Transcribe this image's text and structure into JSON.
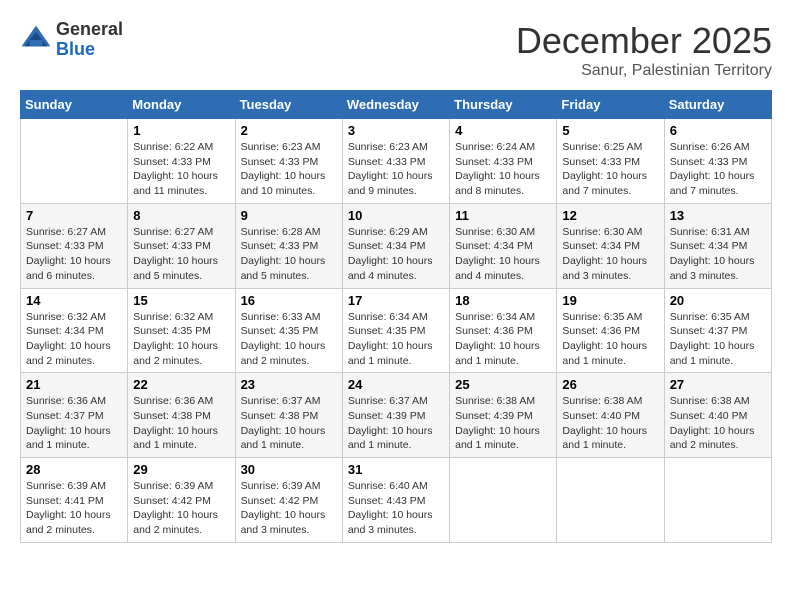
{
  "logo": {
    "general": "General",
    "blue": "Blue"
  },
  "title": "December 2025",
  "subtitle": "Sanur, Palestinian Territory",
  "days_of_week": [
    "Sunday",
    "Monday",
    "Tuesday",
    "Wednesday",
    "Thursday",
    "Friday",
    "Saturday"
  ],
  "weeks": [
    [
      {
        "day": "",
        "info": ""
      },
      {
        "day": "1",
        "info": "Sunrise: 6:22 AM\nSunset: 4:33 PM\nDaylight: 10 hours and 11 minutes."
      },
      {
        "day": "2",
        "info": "Sunrise: 6:23 AM\nSunset: 4:33 PM\nDaylight: 10 hours and 10 minutes."
      },
      {
        "day": "3",
        "info": "Sunrise: 6:23 AM\nSunset: 4:33 PM\nDaylight: 10 hours and 9 minutes."
      },
      {
        "day": "4",
        "info": "Sunrise: 6:24 AM\nSunset: 4:33 PM\nDaylight: 10 hours and 8 minutes."
      },
      {
        "day": "5",
        "info": "Sunrise: 6:25 AM\nSunset: 4:33 PM\nDaylight: 10 hours and 7 minutes."
      },
      {
        "day": "6",
        "info": "Sunrise: 6:26 AM\nSunset: 4:33 PM\nDaylight: 10 hours and 7 minutes."
      }
    ],
    [
      {
        "day": "7",
        "info": "Sunrise: 6:27 AM\nSunset: 4:33 PM\nDaylight: 10 hours and 6 minutes."
      },
      {
        "day": "8",
        "info": "Sunrise: 6:27 AM\nSunset: 4:33 PM\nDaylight: 10 hours and 5 minutes."
      },
      {
        "day": "9",
        "info": "Sunrise: 6:28 AM\nSunset: 4:33 PM\nDaylight: 10 hours and 5 minutes."
      },
      {
        "day": "10",
        "info": "Sunrise: 6:29 AM\nSunset: 4:34 PM\nDaylight: 10 hours and 4 minutes."
      },
      {
        "day": "11",
        "info": "Sunrise: 6:30 AM\nSunset: 4:34 PM\nDaylight: 10 hours and 4 minutes."
      },
      {
        "day": "12",
        "info": "Sunrise: 6:30 AM\nSunset: 4:34 PM\nDaylight: 10 hours and 3 minutes."
      },
      {
        "day": "13",
        "info": "Sunrise: 6:31 AM\nSunset: 4:34 PM\nDaylight: 10 hours and 3 minutes."
      }
    ],
    [
      {
        "day": "14",
        "info": "Sunrise: 6:32 AM\nSunset: 4:34 PM\nDaylight: 10 hours and 2 minutes."
      },
      {
        "day": "15",
        "info": "Sunrise: 6:32 AM\nSunset: 4:35 PM\nDaylight: 10 hours and 2 minutes."
      },
      {
        "day": "16",
        "info": "Sunrise: 6:33 AM\nSunset: 4:35 PM\nDaylight: 10 hours and 2 minutes."
      },
      {
        "day": "17",
        "info": "Sunrise: 6:34 AM\nSunset: 4:35 PM\nDaylight: 10 hours and 1 minute."
      },
      {
        "day": "18",
        "info": "Sunrise: 6:34 AM\nSunset: 4:36 PM\nDaylight: 10 hours and 1 minute."
      },
      {
        "day": "19",
        "info": "Sunrise: 6:35 AM\nSunset: 4:36 PM\nDaylight: 10 hours and 1 minute."
      },
      {
        "day": "20",
        "info": "Sunrise: 6:35 AM\nSunset: 4:37 PM\nDaylight: 10 hours and 1 minute."
      }
    ],
    [
      {
        "day": "21",
        "info": "Sunrise: 6:36 AM\nSunset: 4:37 PM\nDaylight: 10 hours and 1 minute."
      },
      {
        "day": "22",
        "info": "Sunrise: 6:36 AM\nSunset: 4:38 PM\nDaylight: 10 hours and 1 minute."
      },
      {
        "day": "23",
        "info": "Sunrise: 6:37 AM\nSunset: 4:38 PM\nDaylight: 10 hours and 1 minute."
      },
      {
        "day": "24",
        "info": "Sunrise: 6:37 AM\nSunset: 4:39 PM\nDaylight: 10 hours and 1 minute."
      },
      {
        "day": "25",
        "info": "Sunrise: 6:38 AM\nSunset: 4:39 PM\nDaylight: 10 hours and 1 minute."
      },
      {
        "day": "26",
        "info": "Sunrise: 6:38 AM\nSunset: 4:40 PM\nDaylight: 10 hours and 1 minute."
      },
      {
        "day": "27",
        "info": "Sunrise: 6:38 AM\nSunset: 4:40 PM\nDaylight: 10 hours and 2 minutes."
      }
    ],
    [
      {
        "day": "28",
        "info": "Sunrise: 6:39 AM\nSunset: 4:41 PM\nDaylight: 10 hours and 2 minutes."
      },
      {
        "day": "29",
        "info": "Sunrise: 6:39 AM\nSunset: 4:42 PM\nDaylight: 10 hours and 2 minutes."
      },
      {
        "day": "30",
        "info": "Sunrise: 6:39 AM\nSunset: 4:42 PM\nDaylight: 10 hours and 3 minutes."
      },
      {
        "day": "31",
        "info": "Sunrise: 6:40 AM\nSunset: 4:43 PM\nDaylight: 10 hours and 3 minutes."
      },
      {
        "day": "",
        "info": ""
      },
      {
        "day": "",
        "info": ""
      },
      {
        "day": "",
        "info": ""
      }
    ]
  ]
}
